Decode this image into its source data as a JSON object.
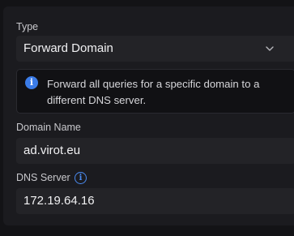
{
  "type_field": {
    "label": "Type",
    "value": "Forward Domain"
  },
  "info": {
    "text": "Forward all queries for a specific domain to a different DNS server."
  },
  "domain_name": {
    "label": "Domain Name",
    "value": "ad.virot.eu"
  },
  "dns_server": {
    "label": "DNS Server",
    "value": "172.19.64.16"
  },
  "colors": {
    "background": "#131316",
    "panel": "#1b1b1f",
    "field": "#232327",
    "accent": "#3b7ce8"
  },
  "icons": {
    "dropdown": "chevron-down-icon",
    "info": "info-icon",
    "help": "help-info-icon"
  }
}
